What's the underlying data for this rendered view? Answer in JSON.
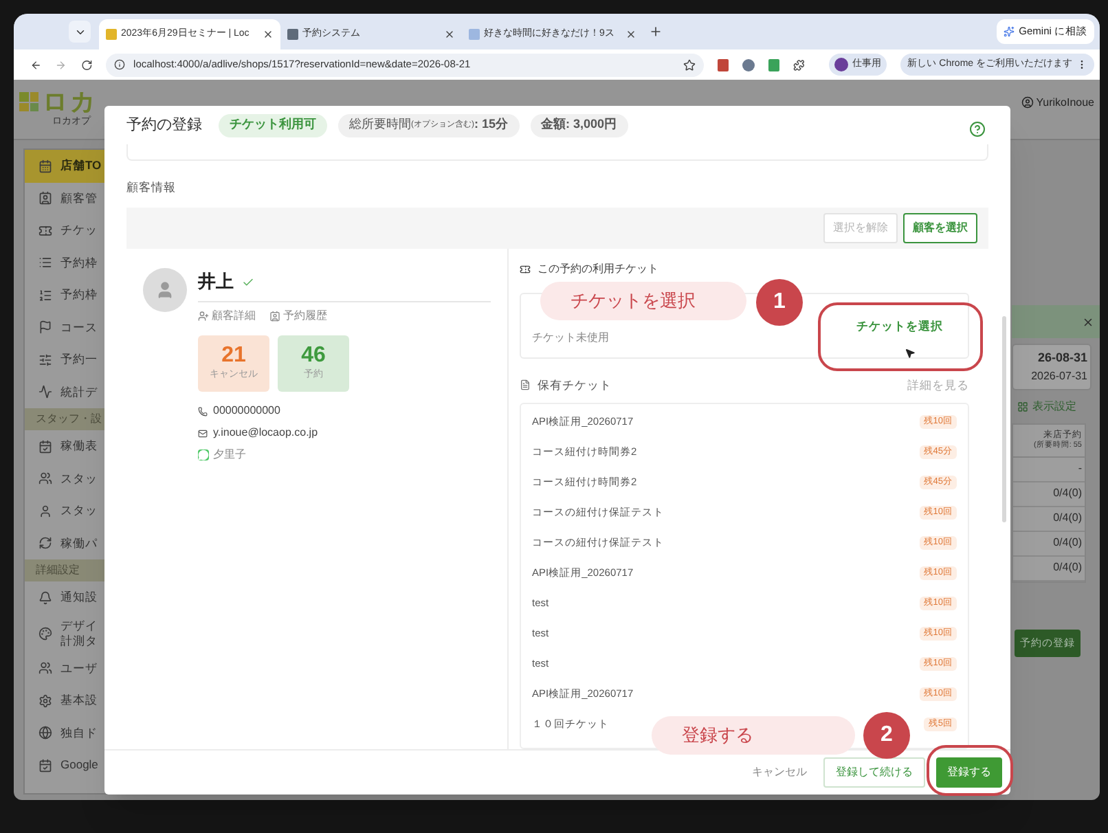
{
  "browser": {
    "tabs": [
      {
        "title": "2023年6月29日セミナー | Loc",
        "selected": true
      },
      {
        "title": "予約システム",
        "selected": false
      },
      {
        "title": "好きな時間に好きなだけ！9ス",
        "selected": false
      }
    ],
    "gemini_button": "Gemini に相談",
    "url": "localhost:4000/a/adlive/shops/1517?reservationId=new&date=2026-08-21",
    "profile": "仕事用",
    "update_chip": "新しい Chrome をご利用いただけます"
  },
  "app": {
    "logo": "ロカ",
    "logo_subtitle": "ロカオプ",
    "user": "YurikoInoue",
    "sidebar": [
      {
        "kind": "item",
        "label": "店舗TO",
        "selected": true
      },
      {
        "kind": "item",
        "label": "顧客管",
        "selected": false
      },
      {
        "kind": "item",
        "label": "チケッ",
        "selected": false
      },
      {
        "kind": "item",
        "label": "予約枠",
        "selected": false
      },
      {
        "kind": "item",
        "label": "予約枠",
        "selected": false
      },
      {
        "kind": "item",
        "label": "コース",
        "selected": false
      },
      {
        "kind": "item",
        "label": "予約一",
        "selected": false
      },
      {
        "kind": "item",
        "label": "統計デ",
        "selected": false
      },
      {
        "kind": "section",
        "label": "スタッフ・設"
      },
      {
        "kind": "item",
        "label": "稼働表",
        "selected": false
      },
      {
        "kind": "item",
        "label": "スタッ",
        "selected": false
      },
      {
        "kind": "item",
        "label": "スタッ",
        "selected": false
      },
      {
        "kind": "item",
        "label": "稼働パ",
        "selected": false
      },
      {
        "kind": "section",
        "label": "詳細設定"
      },
      {
        "kind": "item",
        "label": "通知設",
        "selected": false
      },
      {
        "kind": "item2",
        "label": "デザイ",
        "label2": "計測タ",
        "selected": false
      },
      {
        "kind": "item",
        "label": "ユーザ",
        "selected": false
      },
      {
        "kind": "item",
        "label": "基本設",
        "selected": false
      },
      {
        "kind": "item",
        "label": "独自ド",
        "selected": false
      },
      {
        "kind": "item",
        "label": "Google",
        "selected": false
      }
    ],
    "right_panel": {
      "date_end": "26-08-31",
      "date_start": "2026-07-31",
      "display_settings": "表示設定",
      "column_title": "来店予約",
      "column_note": "(所要時間: 55",
      "cells": [
        "-",
        "0/4(0)",
        "0/4(0)",
        "0/4(0)",
        "0/4(0)"
      ],
      "register_button": "予約の登録"
    }
  },
  "modal": {
    "title": "予約の登録",
    "ticket_chip": "チケット利用可",
    "duration_label": "総所要時間",
    "duration_note": "(オプション含む)",
    "duration_value": ": 15分",
    "price_chip": "金額: 3,000円",
    "customer_section": "顧客情報",
    "deselect_button": {
      "label": "選択を解除",
      "disabled": true
    },
    "select_button": {
      "label": "顧客を選択",
      "disabled": false
    },
    "customer": {
      "name": "井上",
      "verified": true,
      "detail_link": "顧客詳細",
      "history_link": "予約履歴",
      "stats": [
        {
          "value": "21",
          "label": "キャンセル",
          "color": "#e8742c"
        },
        {
          "value": "46",
          "label": "予約",
          "color": "#3e9a3e"
        }
      ],
      "phone": "00000000000",
      "email": "y.inoue@locaop.co.jp",
      "line_name": "夕里子"
    },
    "ticket_heading": "この予約の利用チケット",
    "ticket_status": "チケット未使用",
    "choose_ticket_button": "チケットを選択",
    "owned_heading": "保有チケット",
    "details_link": "詳細を見る",
    "tickets": [
      {
        "name": "API検証用_20260717",
        "remaining": "残10回"
      },
      {
        "name": "コース紐付け時間券2",
        "remaining": "残45分"
      },
      {
        "name": "コース紐付け時間券2",
        "remaining": "残45分"
      },
      {
        "name": "コースの紐付け保証テスト",
        "remaining": "残10回"
      },
      {
        "name": "コースの紐付け保証テスト",
        "remaining": "残10回"
      },
      {
        "name": "API検証用_20260717",
        "remaining": "残10回"
      },
      {
        "name": "test",
        "remaining": "残10回"
      },
      {
        "name": "test",
        "remaining": "残10回"
      },
      {
        "name": "test",
        "remaining": "残10回"
      },
      {
        "name": "API検証用_20260717",
        "remaining": "残10回"
      },
      {
        "name": "１０回チケット",
        "remaining": "残5回"
      }
    ],
    "cancel_link": "キャンセル",
    "save_continue_button": "登録して続ける",
    "save_button": "登録する"
  },
  "annotations": [
    {
      "number": "1",
      "label": "チケットを選択"
    },
    {
      "number": "2",
      "label": "登録する"
    }
  ]
}
